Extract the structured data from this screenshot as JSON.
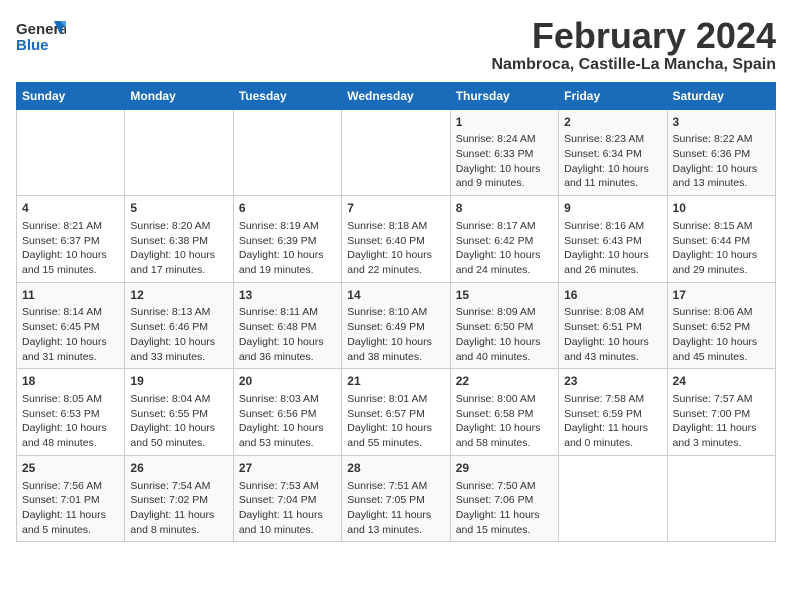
{
  "logo": {
    "general": "General",
    "blue": "Blue"
  },
  "title": "February 2024",
  "subtitle": "Nambroca, Castille-La Mancha, Spain",
  "days_of_week": [
    "Sunday",
    "Monday",
    "Tuesday",
    "Wednesday",
    "Thursday",
    "Friday",
    "Saturday"
  ],
  "weeks": [
    [
      {
        "day": "",
        "info": ""
      },
      {
        "day": "",
        "info": ""
      },
      {
        "day": "",
        "info": ""
      },
      {
        "day": "",
        "info": ""
      },
      {
        "day": "1",
        "info": "Sunrise: 8:24 AM\nSunset: 6:33 PM\nDaylight: 10 hours\nand 9 minutes."
      },
      {
        "day": "2",
        "info": "Sunrise: 8:23 AM\nSunset: 6:34 PM\nDaylight: 10 hours\nand 11 minutes."
      },
      {
        "day": "3",
        "info": "Sunrise: 8:22 AM\nSunset: 6:36 PM\nDaylight: 10 hours\nand 13 minutes."
      }
    ],
    [
      {
        "day": "4",
        "info": "Sunrise: 8:21 AM\nSunset: 6:37 PM\nDaylight: 10 hours\nand 15 minutes."
      },
      {
        "day": "5",
        "info": "Sunrise: 8:20 AM\nSunset: 6:38 PM\nDaylight: 10 hours\nand 17 minutes."
      },
      {
        "day": "6",
        "info": "Sunrise: 8:19 AM\nSunset: 6:39 PM\nDaylight: 10 hours\nand 19 minutes."
      },
      {
        "day": "7",
        "info": "Sunrise: 8:18 AM\nSunset: 6:40 PM\nDaylight: 10 hours\nand 22 minutes."
      },
      {
        "day": "8",
        "info": "Sunrise: 8:17 AM\nSunset: 6:42 PM\nDaylight: 10 hours\nand 24 minutes."
      },
      {
        "day": "9",
        "info": "Sunrise: 8:16 AM\nSunset: 6:43 PM\nDaylight: 10 hours\nand 26 minutes."
      },
      {
        "day": "10",
        "info": "Sunrise: 8:15 AM\nSunset: 6:44 PM\nDaylight: 10 hours\nand 29 minutes."
      }
    ],
    [
      {
        "day": "11",
        "info": "Sunrise: 8:14 AM\nSunset: 6:45 PM\nDaylight: 10 hours\nand 31 minutes."
      },
      {
        "day": "12",
        "info": "Sunrise: 8:13 AM\nSunset: 6:46 PM\nDaylight: 10 hours\nand 33 minutes."
      },
      {
        "day": "13",
        "info": "Sunrise: 8:11 AM\nSunset: 6:48 PM\nDaylight: 10 hours\nand 36 minutes."
      },
      {
        "day": "14",
        "info": "Sunrise: 8:10 AM\nSunset: 6:49 PM\nDaylight: 10 hours\nand 38 minutes."
      },
      {
        "day": "15",
        "info": "Sunrise: 8:09 AM\nSunset: 6:50 PM\nDaylight: 10 hours\nand 40 minutes."
      },
      {
        "day": "16",
        "info": "Sunrise: 8:08 AM\nSunset: 6:51 PM\nDaylight: 10 hours\nand 43 minutes."
      },
      {
        "day": "17",
        "info": "Sunrise: 8:06 AM\nSunset: 6:52 PM\nDaylight: 10 hours\nand 45 minutes."
      }
    ],
    [
      {
        "day": "18",
        "info": "Sunrise: 8:05 AM\nSunset: 6:53 PM\nDaylight: 10 hours\nand 48 minutes."
      },
      {
        "day": "19",
        "info": "Sunrise: 8:04 AM\nSunset: 6:55 PM\nDaylight: 10 hours\nand 50 minutes."
      },
      {
        "day": "20",
        "info": "Sunrise: 8:03 AM\nSunset: 6:56 PM\nDaylight: 10 hours\nand 53 minutes."
      },
      {
        "day": "21",
        "info": "Sunrise: 8:01 AM\nSunset: 6:57 PM\nDaylight: 10 hours\nand 55 minutes."
      },
      {
        "day": "22",
        "info": "Sunrise: 8:00 AM\nSunset: 6:58 PM\nDaylight: 10 hours\nand 58 minutes."
      },
      {
        "day": "23",
        "info": "Sunrise: 7:58 AM\nSunset: 6:59 PM\nDaylight: 11 hours\nand 0 minutes."
      },
      {
        "day": "24",
        "info": "Sunrise: 7:57 AM\nSunset: 7:00 PM\nDaylight: 11 hours\nand 3 minutes."
      }
    ],
    [
      {
        "day": "25",
        "info": "Sunrise: 7:56 AM\nSunset: 7:01 PM\nDaylight: 11 hours\nand 5 minutes."
      },
      {
        "day": "26",
        "info": "Sunrise: 7:54 AM\nSunset: 7:02 PM\nDaylight: 11 hours\nand 8 minutes."
      },
      {
        "day": "27",
        "info": "Sunrise: 7:53 AM\nSunset: 7:04 PM\nDaylight: 11 hours\nand 10 minutes."
      },
      {
        "day": "28",
        "info": "Sunrise: 7:51 AM\nSunset: 7:05 PM\nDaylight: 11 hours\nand 13 minutes."
      },
      {
        "day": "29",
        "info": "Sunrise: 7:50 AM\nSunset: 7:06 PM\nDaylight: 11 hours\nand 15 minutes."
      },
      {
        "day": "",
        "info": ""
      },
      {
        "day": "",
        "info": ""
      }
    ]
  ]
}
